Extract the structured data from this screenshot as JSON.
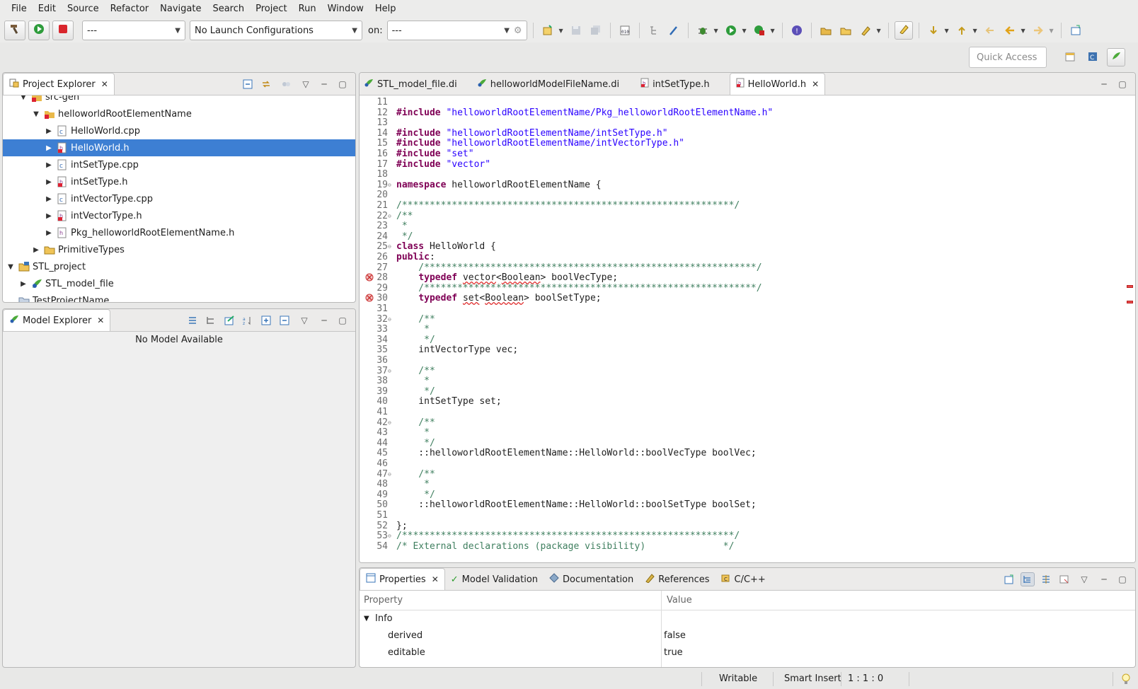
{
  "menu": [
    "File",
    "Edit",
    "Source",
    "Refactor",
    "Navigate",
    "Search",
    "Project",
    "Run",
    "Window",
    "Help"
  ],
  "toolbar": {
    "mode_value": "---",
    "launch_config": "No Launch Configurations",
    "on_label": "on:",
    "target_value": "---",
    "quick_access": "Quick Access"
  },
  "project_explorer": {
    "title": "Project Explorer",
    "items": [
      {
        "label": "src-gen",
        "icon": "source-folder-icon"
      },
      {
        "label": "helloworldRootElementName",
        "icon": "namespace-folder-icon"
      },
      {
        "label": "HelloWorld.cpp",
        "icon": "cpp-file-icon"
      },
      {
        "label": "HelloWorld.h",
        "icon": "header-file-icon"
      },
      {
        "label": "intSetType.cpp",
        "icon": "cpp-file-icon"
      },
      {
        "label": "intSetType.h",
        "icon": "header-file-icon"
      },
      {
        "label": "intVectorType.cpp",
        "icon": "cpp-file-icon"
      },
      {
        "label": "intVectorType.h",
        "icon": "header-file-icon"
      },
      {
        "label": "Pkg_helloworldRootElementName.h",
        "icon": "header-file-icon"
      },
      {
        "label": "PrimitiveTypes",
        "icon": "folder-icon"
      },
      {
        "label": "STL_project",
        "icon": "project-icon"
      },
      {
        "label": "STL_model_file",
        "icon": "papyrus-model-icon"
      },
      {
        "label": "TestProjectName",
        "icon": "project-icon"
      }
    ]
  },
  "model_explorer": {
    "title": "Model Explorer",
    "empty_text": "No Model Available"
  },
  "editor_tabs": [
    "STL_model_file.di",
    "helloworldModelFileName.di",
    "intSetType.h",
    "HelloWorld.h"
  ],
  "code_lines": [
    {
      "n": "11",
      "t": ""
    },
    {
      "n": "12",
      "t": "#include \"helloworldRootElementName/Pkg_helloworldRootElementName.h\""
    },
    {
      "n": "13",
      "t": ""
    },
    {
      "n": "14",
      "t": "#include \"helloworldRootElementName/intSetType.h\""
    },
    {
      "n": "15",
      "t": "#include \"helloworldRootElementName/intVectorType.h\""
    },
    {
      "n": "16",
      "t": "#include \"set\""
    },
    {
      "n": "17",
      "t": "#include \"vector\""
    },
    {
      "n": "18",
      "t": ""
    },
    {
      "n": "19",
      "t": "namespace helloworldRootElementName {"
    },
    {
      "n": "20",
      "t": ""
    },
    {
      "n": "21",
      "t": "/************************************************************/"
    },
    {
      "n": "22",
      "t": "/**"
    },
    {
      "n": "23",
      "t": " *"
    },
    {
      "n": "24",
      "t": " */"
    },
    {
      "n": "25",
      "t": "class HelloWorld {"
    },
    {
      "n": "26",
      "t": "public:"
    },
    {
      "n": "27",
      "t": "    /************************************************************/"
    },
    {
      "n": "28",
      "t": "    typedef vector<Boolean> boolVecType;"
    },
    {
      "n": "29",
      "t": "    /************************************************************/"
    },
    {
      "n": "30",
      "t": "    typedef set<Boolean> boolSetType;"
    },
    {
      "n": "31",
      "t": ""
    },
    {
      "n": "32",
      "t": "    /**"
    },
    {
      "n": "33",
      "t": "     *"
    },
    {
      "n": "34",
      "t": "     */"
    },
    {
      "n": "35",
      "t": "    intVectorType vec;"
    },
    {
      "n": "36",
      "t": ""
    },
    {
      "n": "37",
      "t": "    /**"
    },
    {
      "n": "38",
      "t": "     *"
    },
    {
      "n": "39",
      "t": "     */"
    },
    {
      "n": "40",
      "t": "    intSetType set;"
    },
    {
      "n": "41",
      "t": ""
    },
    {
      "n": "42",
      "t": "    /**"
    },
    {
      "n": "43",
      "t": "     *"
    },
    {
      "n": "44",
      "t": "     */"
    },
    {
      "n": "45",
      "t": "    ::helloworldRootElementName::HelloWorld::boolVecType boolVec;"
    },
    {
      "n": "46",
      "t": ""
    },
    {
      "n": "47",
      "t": "    /**"
    },
    {
      "n": "48",
      "t": "     *"
    },
    {
      "n": "49",
      "t": "     */"
    },
    {
      "n": "50",
      "t": "    ::helloworldRootElementName::HelloWorld::boolSetType boolSet;"
    },
    {
      "n": "51",
      "t": ""
    },
    {
      "n": "52",
      "t": "};"
    },
    {
      "n": "53",
      "t": "/************************************************************/"
    },
    {
      "n": "54",
      "t": "/* External declarations (package visibility)              */"
    }
  ],
  "bottom_tabs": [
    "Properties",
    "Model Validation",
    "Documentation",
    "References",
    "C/C++"
  ],
  "properties": {
    "col_property": "Property",
    "col_value": "Value",
    "group": "Info",
    "rows": [
      {
        "name": "derived",
        "value": "false"
      },
      {
        "name": "editable",
        "value": "true"
      }
    ]
  },
  "status": {
    "writable": "Writable",
    "insert_mode": "Smart Insert",
    "position": "1 : 1 : 0"
  },
  "colors": {
    "selection": "#3d7fd3",
    "keyword": "#7f0055",
    "string": "#2a00ff",
    "comment": "#3f7f5f"
  }
}
